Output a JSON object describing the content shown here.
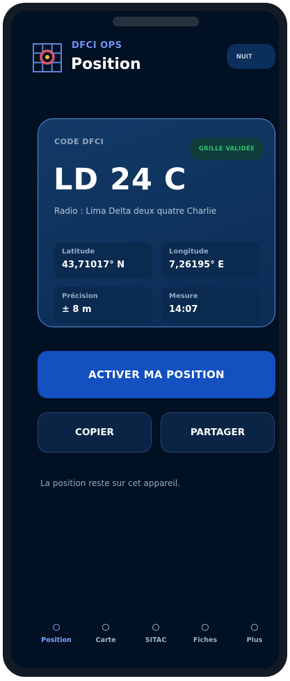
{
  "header": {
    "brand": "DFCI OPS",
    "title": "Position",
    "night_label": "NUIT",
    "logo_icon": "grid-target-icon"
  },
  "card": {
    "code_label": "CODE DFCI",
    "badge": "GRILLE VALIDÉE",
    "code": "LD 24 C",
    "radio": "Radio : Lima Delta deux quatre Charlie",
    "fields": [
      {
        "label": "Latitude",
        "value": "43,71017° N"
      },
      {
        "label": "Longitude",
        "value": "7,26195° E"
      },
      {
        "label": "Précision",
        "value": "± 8 m"
      },
      {
        "label": "Mesure",
        "value": "14:07"
      }
    ]
  },
  "actions": {
    "activate": "ACTIVER MA POSITION",
    "copy": "COPIER",
    "share": "PARTAGER"
  },
  "note": "La position reste sur cet appareil.",
  "nav": [
    {
      "label": "Position",
      "active": true
    },
    {
      "label": "Carte",
      "active": false
    },
    {
      "label": "SITAC",
      "active": false
    },
    {
      "label": "Fiches",
      "active": false
    },
    {
      "label": "Plus",
      "active": false
    }
  ],
  "colors": {
    "background": "#021024",
    "accent": "#1450c0",
    "brand": "#6f93f5",
    "badge_text": "#2ec06c",
    "logo_ring": "#e0566e"
  }
}
